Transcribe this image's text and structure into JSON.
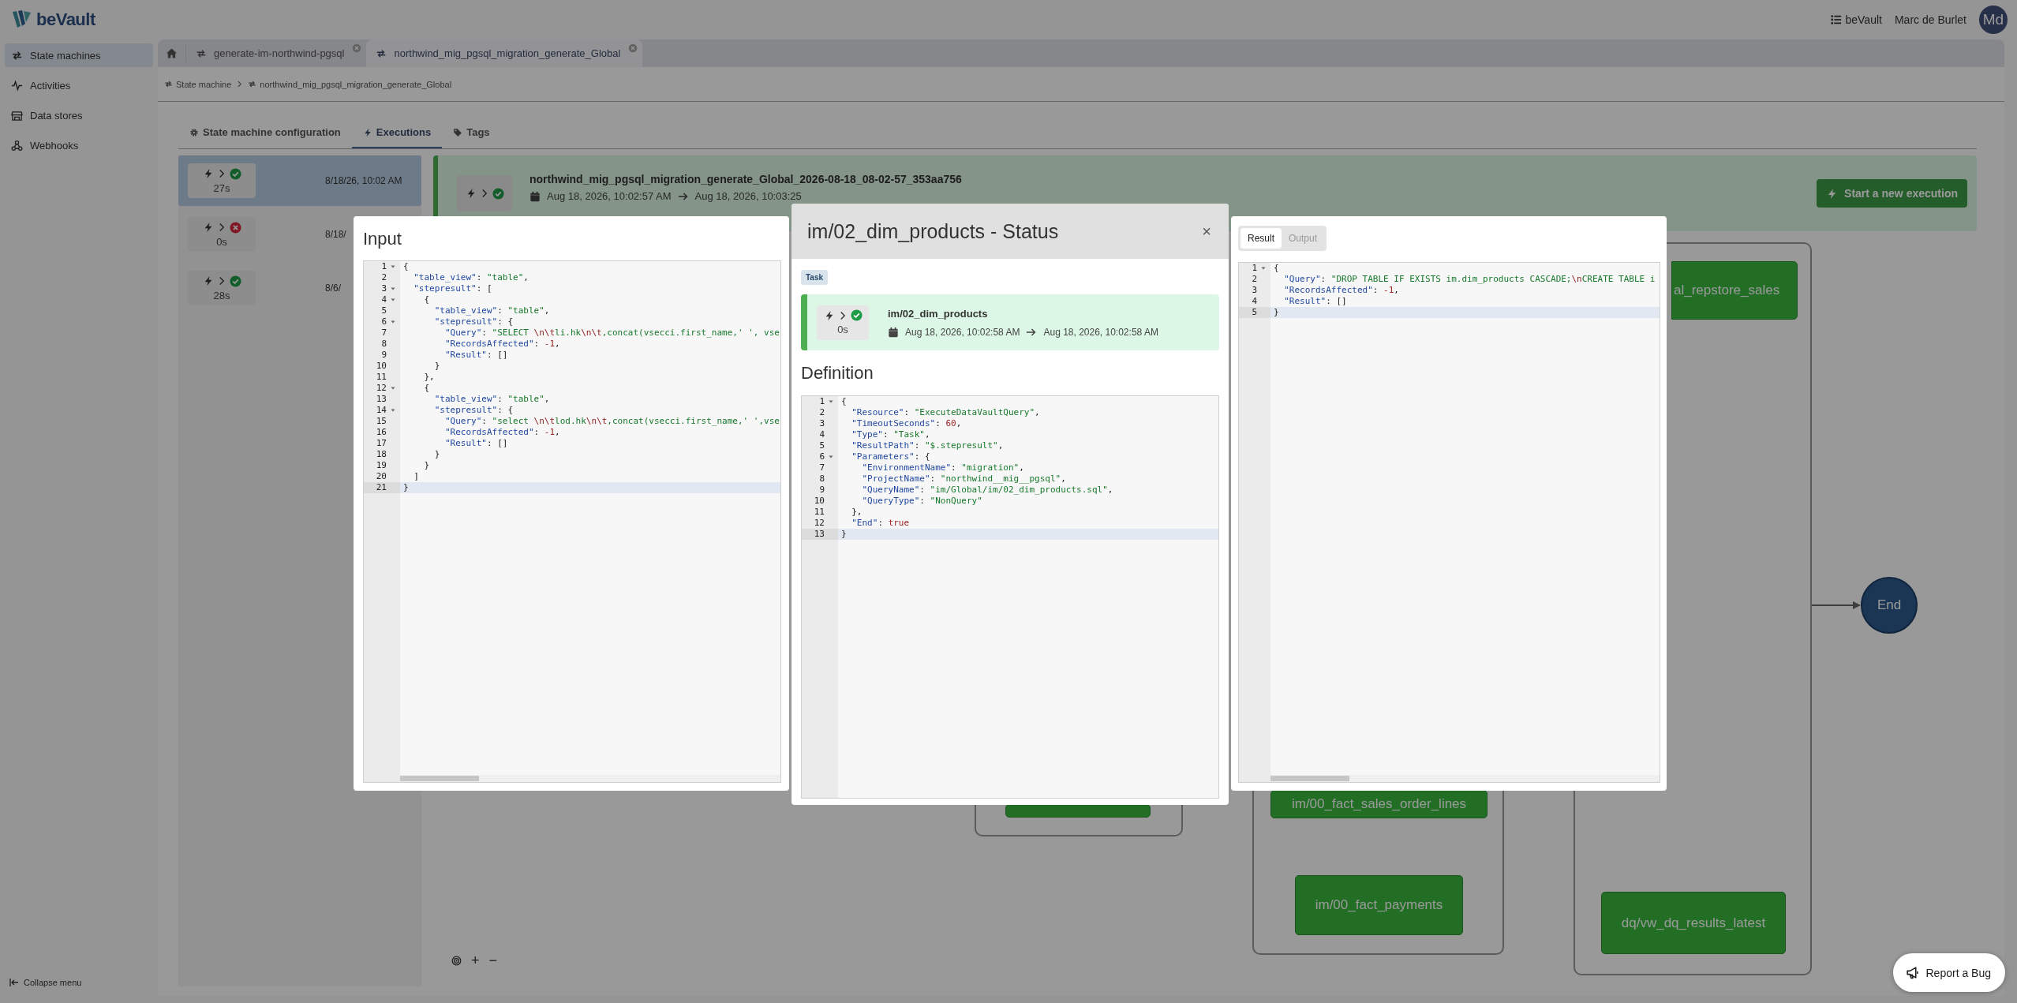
{
  "header": {
    "logo": "beVault",
    "menu_label": "beVault",
    "user_name": "Marc de Burlet",
    "avatar_initials": "Md"
  },
  "sidebar": {
    "items": [
      {
        "kind": "state_machines",
        "label": "State machines",
        "selected": true
      },
      {
        "kind": "activities",
        "label": "Activities",
        "selected": false
      },
      {
        "kind": "data_stores",
        "label": "Data stores",
        "selected": false
      },
      {
        "kind": "webhooks",
        "label": "Webhooks",
        "selected": false
      }
    ],
    "collapse_label": "Collapse menu"
  },
  "tabs": [
    {
      "kind": "home",
      "selected": false
    },
    {
      "kind": "state_machine",
      "label": "generate-im-northwind-pgsql",
      "selected": false,
      "closable": true
    },
    {
      "kind": "state_machine",
      "label": "northwind_mig_pgsql_migration_generate_Global",
      "selected": true,
      "closable": true
    }
  ],
  "breadcrumb": [
    "State machine",
    "northwind_mig_pgsql_migration_generate_Global"
  ],
  "section_tabs": [
    {
      "kind": "gear",
      "label": "State machine configuration",
      "selected": false
    },
    {
      "kind": "bolt",
      "label": "Executions",
      "selected": true
    },
    {
      "kind": "tag",
      "label": "Tags",
      "selected": false
    }
  ],
  "executions": [
    {
      "failed": false,
      "duration": "27s",
      "date": "8/18/26, 10:02 AM",
      "selected": true
    },
    {
      "failed": true,
      "duration": "0s",
      "date": "8/18/",
      "selected": false
    },
    {
      "failed": false,
      "duration": "28s",
      "date": "8/6/",
      "selected": false
    }
  ],
  "execution_detail": {
    "failed": false,
    "name": "northwind_mig_pgsql_migration_generate_Global_2026-08-18_08-02-57_353aa756",
    "start": "Aug 18, 2026, 10:02:57 AM",
    "end": "Aug 18, 2026, 10:03:25",
    "start_button": "Start a new execution"
  },
  "graph": {
    "nodes": [
      {
        "kind": "task",
        "label": "al_repstore_sales"
      },
      {
        "kind": "task"
      },
      {
        "kind": "task",
        "label": "im/00_fact_sales_order_lines"
      },
      {
        "kind": "task",
        "label": "im/00_fact_payments"
      },
      {
        "kind": "task",
        "label": "dq/vw_dq_results_latest"
      },
      {
        "kind": "end",
        "label": "End"
      }
    ],
    "zoom_in": "+",
    "zoom_out": "−"
  },
  "input_panel": {
    "title": "Input",
    "editor": {
      "lines": [
        {
          "number": "1",
          "code": "{",
          "foldable": true,
          "active": false
        },
        {
          "number": "2",
          "code": "  \"table_view\": \"table\",",
          "foldable": false,
          "active": false
        },
        {
          "number": "3",
          "code": "  \"stepresult\": [",
          "foldable": true,
          "active": false
        },
        {
          "number": "4",
          "code": "    {",
          "foldable": true,
          "active": false
        },
        {
          "number": "5",
          "code": "      \"table_view\": \"table\",",
          "foldable": false,
          "active": false
        },
        {
          "number": "6",
          "code": "      \"stepresult\": {",
          "foldable": true,
          "active": false
        },
        {
          "number": "7",
          "code": "        \"Query\": \"SELECT \\n\\tli.hk\\n\\t,concat(vsecci.first_name,' ', vse",
          "foldable": false,
          "active": false
        },
        {
          "number": "8",
          "code": "        \"RecordsAffected\": -1,",
          "foldable": false,
          "active": false
        },
        {
          "number": "9",
          "code": "        \"Result\": []",
          "foldable": false,
          "active": false
        },
        {
          "number": "10",
          "code": "      }",
          "foldable": false,
          "active": false
        },
        {
          "number": "11",
          "code": "    },",
          "foldable": false,
          "active": false
        },
        {
          "number": "12",
          "code": "    {",
          "foldable": true,
          "active": false
        },
        {
          "number": "13",
          "code": "      \"table_view\": \"table\",",
          "foldable": false,
          "active": false
        },
        {
          "number": "14",
          "code": "      \"stepresult\": {",
          "foldable": true,
          "active": false
        },
        {
          "number": "15",
          "code": "        \"Query\": \"select \\n\\tlod.hk\\n\\t,concat(vsecci.first_name,' ',vse",
          "foldable": false,
          "active": false
        },
        {
          "number": "16",
          "code": "        \"RecordsAffected\": -1,",
          "foldable": false,
          "active": false
        },
        {
          "number": "17",
          "code": "        \"Result\": []",
          "foldable": false,
          "active": false
        },
        {
          "number": "18",
          "code": "      }",
          "foldable": false,
          "active": false
        },
        {
          "number": "19",
          "code": "    }",
          "foldable": false,
          "active": false
        },
        {
          "number": "20",
          "code": "  ]",
          "foldable": false,
          "active": false
        },
        {
          "number": "21",
          "code": "}",
          "foldable": false,
          "active": true
        }
      ]
    }
  },
  "status_modal": {
    "title": "im/02_dim_products - Status",
    "close": "×",
    "badge": "Task",
    "state": {
      "failed": false,
      "duration": "0s",
      "name": "im/02_dim_products",
      "start": "Aug 18, 2026, 10:02:58 AM",
      "end": "Aug 18, 2026, 10:02:58 AM"
    },
    "definition_title": "Definition",
    "editor": {
      "lines": [
        {
          "number": "1",
          "code": "{",
          "foldable": true,
          "active": false
        },
        {
          "number": "2",
          "code": "  \"Resource\": \"ExecuteDataVaultQuery\",",
          "foldable": false,
          "active": false
        },
        {
          "number": "3",
          "code": "  \"TimeoutSeconds\": 60,",
          "foldable": false,
          "active": false
        },
        {
          "number": "4",
          "code": "  \"Type\": \"Task\",",
          "foldable": false,
          "active": false
        },
        {
          "number": "5",
          "code": "  \"ResultPath\": \"$.stepresult\",",
          "foldable": false,
          "active": false
        },
        {
          "number": "6",
          "code": "  \"Parameters\": {",
          "foldable": true,
          "active": false
        },
        {
          "number": "7",
          "code": "    \"EnvironmentName\": \"migration\",",
          "foldable": false,
          "active": false
        },
        {
          "number": "8",
          "code": "    \"ProjectName\": \"northwind__mig__pgsql\",",
          "foldable": false,
          "active": false
        },
        {
          "number": "9",
          "code": "    \"QueryName\": \"im/Global/im/02_dim_products.sql\",",
          "foldable": false,
          "active": false
        },
        {
          "number": "10",
          "code": "    \"QueryType\": \"NonQuery\"",
          "foldable": false,
          "active": false
        },
        {
          "number": "11",
          "code": "  },",
          "foldable": false,
          "active": false
        },
        {
          "number": "12",
          "code": "  \"End\": true",
          "foldable": false,
          "active": false
        },
        {
          "number": "13",
          "code": "}",
          "foldable": false,
          "active": true
        }
      ]
    }
  },
  "result_panel": {
    "tabs": [
      {
        "label": "Result",
        "selected": true
      },
      {
        "label": "Output",
        "selected": false
      }
    ],
    "editor": {
      "lines": [
        {
          "number": "1",
          "code": "{",
          "foldable": true,
          "active": false
        },
        {
          "number": "2",
          "code": "  \"Query\": \"DROP TABLE IF EXISTS im.dim_products CASCADE;\\nCREATE TABLE i",
          "foldable": false,
          "active": false
        },
        {
          "number": "3",
          "code": "  \"RecordsAffected\": -1,",
          "foldable": false,
          "active": false
        },
        {
          "number": "4",
          "code": "  \"Result\": []",
          "foldable": false,
          "active": false
        },
        {
          "number": "5",
          "code": "}",
          "foldable": false,
          "active": true
        }
      ]
    }
  },
  "report_bug": "Report a Bug"
}
